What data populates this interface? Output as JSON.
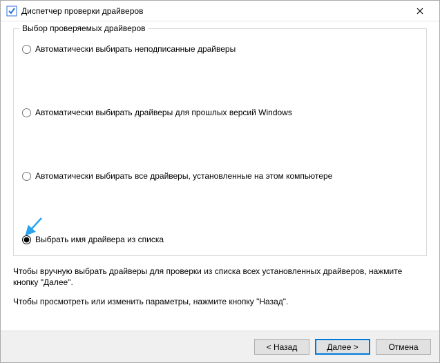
{
  "window": {
    "title": "Диспетчер проверки драйверов"
  },
  "group": {
    "legend": "Выбор проверяемых драйверов",
    "options": [
      {
        "label": "Автоматически выбирать неподписанные драйверы",
        "selected": false
      },
      {
        "label": "Автоматически выбирать драйверы для прошлых версий Windows",
        "selected": false
      },
      {
        "label": "Автоматически выбирать все драйверы, установленные на этом компьютере",
        "selected": false
      },
      {
        "label": "Выбрать имя драйвера из списка",
        "selected": true
      }
    ]
  },
  "instructions": {
    "line1": "Чтобы вручную выбрать драйверы для проверки из списка всех установленных драйверов, нажмите кнопку \"Далее\".",
    "line2": "Чтобы просмотреть или изменить параметры, нажмите кнопку \"Назад\"."
  },
  "buttons": {
    "back": "< Назад",
    "next": "Далее >",
    "cancel": "Отмена"
  },
  "annotation": {
    "arrow_color": "#2aa3ef"
  }
}
